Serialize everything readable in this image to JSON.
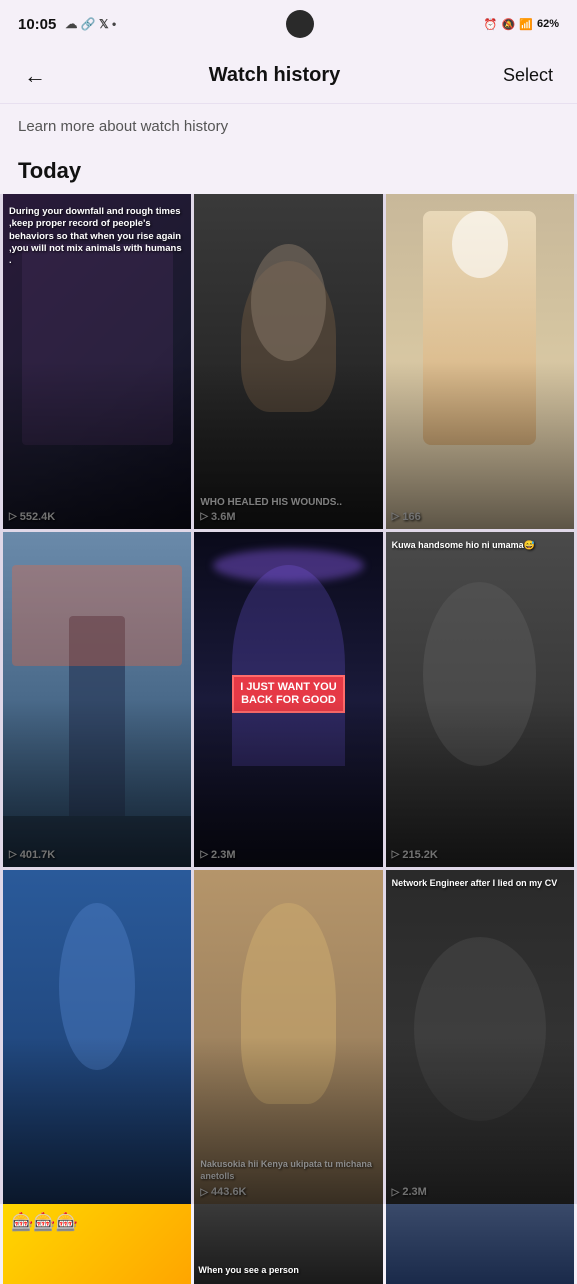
{
  "statusBar": {
    "time": "10:05",
    "battery": "62%"
  },
  "topNav": {
    "backIcon": "←",
    "title": "Watch history",
    "selectLabel": "Select"
  },
  "learnMore": {
    "text": "Learn more about watch history"
  },
  "sections": [
    {
      "label": "Today",
      "videos": [
        {
          "id": 1,
          "caption": "During your downfall and rough times ,keep proper record of people's behaviors so that when you rise again ,you will not mix animals with humans .",
          "captionPosition": "middle",
          "stats": "552.4K",
          "colorClass": "vid-1"
        },
        {
          "id": 2,
          "caption": "WHO HEALED HIS WOUNDS..",
          "captionPosition": "bottom",
          "stats": "3.6M",
          "colorClass": "vid-2"
        },
        {
          "id": 3,
          "caption": "",
          "captionPosition": "bottom",
          "stats": "166",
          "colorClass": "vid-3"
        },
        {
          "id": 4,
          "caption": "",
          "captionPosition": "bottom",
          "stats": "401.7K",
          "colorClass": "vid-4"
        },
        {
          "id": 5,
          "caption": "I JUST WANT YOU BACK FOR GOOD",
          "captionPosition": "middle",
          "stats": "2.3M",
          "colorClass": "vid-5",
          "highlight": true
        },
        {
          "id": 6,
          "caption": "Kuwa handsome hio ni umama😅",
          "captionPosition": "middle",
          "stats": "215.2K",
          "colorClass": "vid-6"
        },
        {
          "id": 7,
          "caption": "",
          "captionPosition": "bottom",
          "stats": "",
          "colorClass": "vid-7"
        },
        {
          "id": 8,
          "caption": "Nakusokia hii Kenya ukipata tu michana anetolls",
          "captionPosition": "middle",
          "stats": "443.6K",
          "colorClass": "vid-8"
        },
        {
          "id": 9,
          "caption": "Network Engineer after I lied on my CV",
          "captionPosition": "top",
          "stats": "2.3M",
          "colorClass": "vid-9"
        }
      ]
    }
  ],
  "partialVideos": [
    {
      "id": 10,
      "emoji": "🎰🎰🎰",
      "colorClass": "partial-1"
    },
    {
      "id": 11,
      "caption": "When you see a person",
      "colorClass": "partial-2"
    },
    {
      "id": 12,
      "caption": "",
      "colorClass": "partial-3"
    }
  ]
}
